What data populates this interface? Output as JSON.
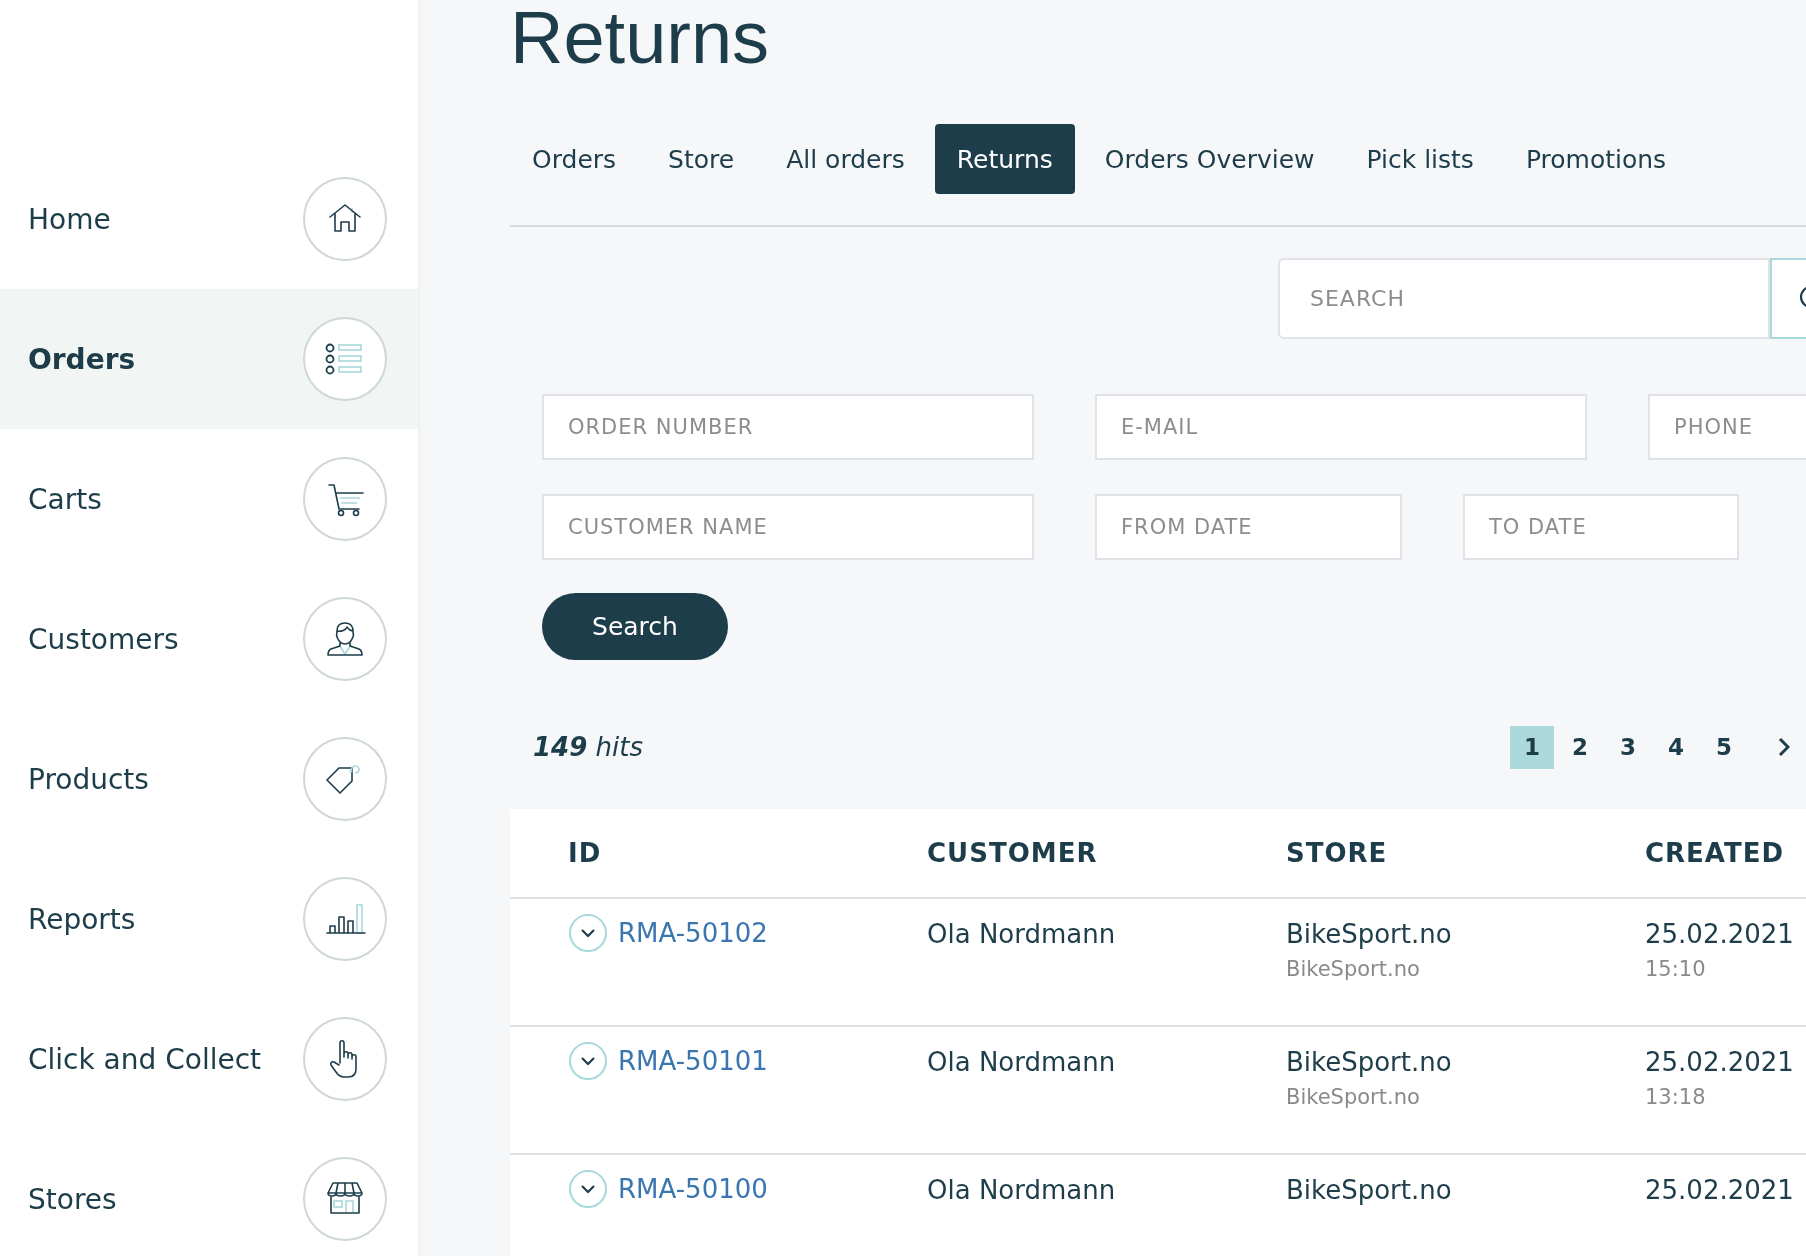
{
  "page_title": "Returns",
  "sidebar": {
    "items": [
      {
        "label": "Home",
        "selected": false
      },
      {
        "label": "Orders",
        "selected": true
      },
      {
        "label": "Carts",
        "selected": false
      },
      {
        "label": "Customers",
        "selected": false
      },
      {
        "label": "Products",
        "selected": false
      },
      {
        "label": "Reports",
        "selected": false
      },
      {
        "label": "Click and Collect",
        "selected": false
      },
      {
        "label": "Stores",
        "selected": false
      }
    ]
  },
  "tabs": [
    {
      "label": "Orders",
      "selected": false
    },
    {
      "label": "Store",
      "selected": false
    },
    {
      "label": "All orders",
      "selected": false
    },
    {
      "label": "Returns",
      "selected": true
    },
    {
      "label": "Orders Overview",
      "selected": false
    },
    {
      "label": "Pick lists",
      "selected": false
    },
    {
      "label": "Promotions",
      "selected": false
    }
  ],
  "search": {
    "placeholder": "SEARCH"
  },
  "filters": [
    [
      {
        "placeholder": "ORDER NUMBER"
      },
      {
        "placeholder": "E-MAIL"
      },
      {
        "placeholder": "PHONE"
      }
    ],
    [
      {
        "placeholder": "CUSTOMER NAME"
      },
      {
        "placeholder": "FROM DATE"
      },
      {
        "placeholder": "TO DATE"
      }
    ]
  ],
  "search_button": "Search",
  "hits": "**149** hits",
  "pagination": [
    {
      "label": "1",
      "selected": true
    },
    {
      "label": "2",
      "selected": false
    },
    {
      "label": "3",
      "selected": false
    },
    {
      "label": "4",
      "selected": false
    },
    {
      "label": "5",
      "selected": false
    }
  ],
  "table": {
    "columns": [
      "ID",
      "CUSTOMER",
      "STORE",
      "CREATED"
    ],
    "rows": [
      {
        "id": "RMA-50102",
        "customer": "Ola Nordmann",
        "store": "BikeSport.no",
        "store_sub": "BikeSport.no",
        "date": "25.02.2021",
        "time": "15:10"
      },
      {
        "id": "RMA-50101",
        "customer": "Ola Nordmann",
        "store": "BikeSport.no",
        "store_sub": "BikeSport.no",
        "date": "25.02.2021",
        "time": "13:18"
      },
      {
        "id": "RMA-50100",
        "customer": "Ola Nordmann",
        "store": "BikeSport.no",
        "date": "25.02.2021"
      }
    ]
  }
}
